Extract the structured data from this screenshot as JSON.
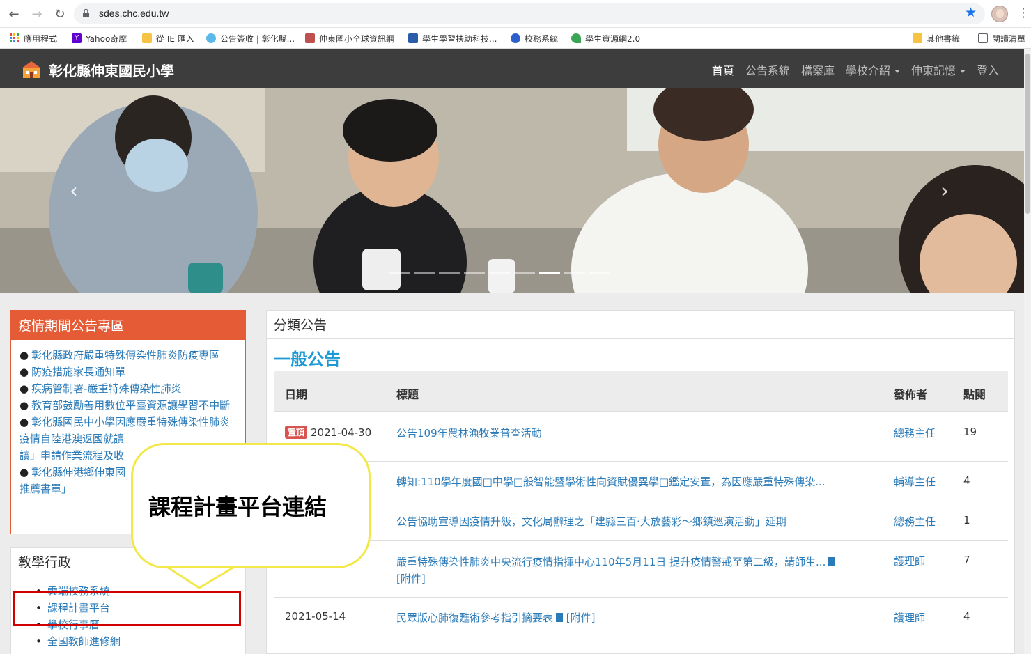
{
  "browser": {
    "url": "sdes.chc.edu.tw",
    "bookmarks": [
      {
        "label": "應用程式",
        "icon": "apps-grid-icon"
      },
      {
        "label": "Yahoo奇摩",
        "icon": "yahoo-icon"
      },
      {
        "label": "從 IE 匯入",
        "icon": "folder-icon"
      },
      {
        "label": "公告簽收 | 彰化縣...",
        "icon": "cloud-icon"
      },
      {
        "label": "伸東國小全球資訊網",
        "icon": "school-icon"
      },
      {
        "label": "學生學習扶助科技...",
        "icon": "logo-icon"
      },
      {
        "label": "校務系統",
        "icon": "chrome-icon"
      },
      {
        "label": "學生資源網2.0",
        "icon": "sprout-icon"
      },
      {
        "label": "其他書籤",
        "icon": "folder-icon"
      },
      {
        "label": "閱讀清單",
        "icon": "reading-list-icon"
      }
    ]
  },
  "site": {
    "title": "彰化縣伸東國民小學",
    "menu": [
      {
        "label": "首頁",
        "active": true,
        "dropdown": false
      },
      {
        "label": "公告系統",
        "active": false,
        "dropdown": false
      },
      {
        "label": "檔案庫",
        "active": false,
        "dropdown": false
      },
      {
        "label": "學校介紹",
        "active": false,
        "dropdown": true
      },
      {
        "label": "伸東記憶",
        "active": false,
        "dropdown": true
      },
      {
        "label": "登入",
        "active": false,
        "dropdown": false
      }
    ]
  },
  "covid_panel": {
    "title": "疫情期間公告專區",
    "items": [
      "彰化縣政府嚴重特殊傳染性肺炎防疫專區",
      "防疫措施家長通知單",
      "疾病管制署-嚴重特殊傳染性肺炎",
      "教育部鼓勵善用數位平臺資源讓學習不中斷",
      "彰化縣國民中小學因應嚴重特殊傳染性肺炎疫情自陸港澳返國就讀",
      "讀」申請作業流程及收",
      "彰化縣伸港鄉伸東國",
      "推薦書單」"
    ]
  },
  "admin_panel": {
    "title": "教學行政",
    "items": [
      "雲端校務系統",
      "課程計畫平台",
      "學校行事曆",
      "全國教師進修網"
    ]
  },
  "callout": {
    "text": "課程計畫平台連結"
  },
  "announcements": {
    "section_title": "分類公告",
    "category": "一般公告",
    "headers": {
      "date": "日期",
      "title": "標題",
      "author": "發佈者",
      "views": "點閱"
    },
    "pinned_label": "置頂",
    "attachment_label": "[附件]",
    "rows": [
      {
        "date": "2021-04-30",
        "pinned": true,
        "title": "公告109年農林漁牧業普查活動",
        "author": "總務主任",
        "views": "19"
      },
      {
        "date": "",
        "pinned": false,
        "title": "轉知:110學年度國□中學□般智能暨學術性向資賦優異學□鑑定安置，為因應嚴重特殊傳染...",
        "author": "輔導主任",
        "views": "4"
      },
      {
        "date": "",
        "pinned": false,
        "title": "公告協助宣導因疫情升級，文化局辦理之「建縣三百·大放藝彩～鄉鎮巡演活動」延期",
        "author": "總務主任",
        "views": "1"
      },
      {
        "date": "",
        "pinned": false,
        "title": "嚴重特殊傳染性肺炎中央流行疫情指揮中心110年5月11日 提升疫情警戒至第二級，請師生...",
        "author": "護理師",
        "views": "7",
        "attachment": true
      },
      {
        "date": "2021-05-14",
        "pinned": false,
        "title": "民眾版心肺復甦術參考指引摘要表",
        "author": "護理師",
        "views": "4",
        "attachment": true
      }
    ]
  }
}
